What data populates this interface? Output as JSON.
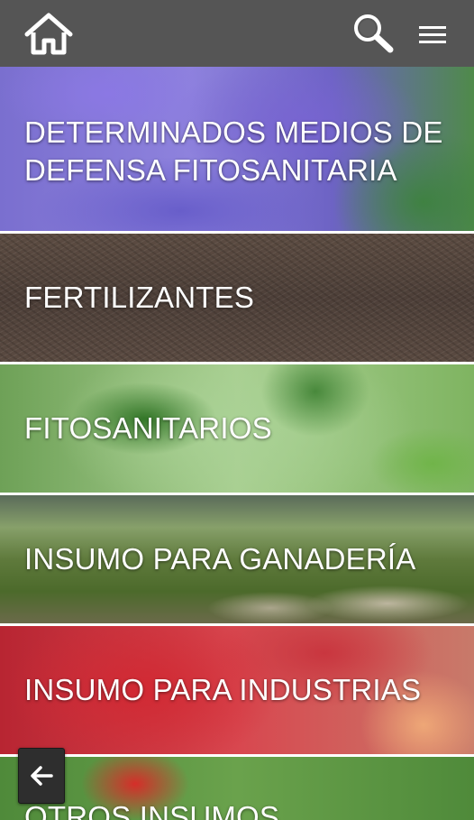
{
  "header": {
    "home_icon": "home-icon",
    "search_icon": "search-icon",
    "menu_icon": "hamburger-menu-icon",
    "bar_color": "#555555"
  },
  "categories": [
    {
      "label": "DETERMINADOS MEDIOS DE DEFENSA FITOSANITARIA",
      "image": "lavender-field"
    },
    {
      "label": "FERTILIZANTES",
      "image": "soil-mulch"
    },
    {
      "label": "FITOSANITARIOS",
      "image": "green-leaves"
    },
    {
      "label": "INSUMO PARA GANADERÍA",
      "image": "sheep-pasture"
    },
    {
      "label": "INSUMO PARA INDUSTRIAS",
      "image": "jam-jars"
    },
    {
      "label": "OTROS INSUMOS",
      "image": "red-poppy"
    }
  ],
  "back_button": {
    "icon": "arrow-left-icon"
  }
}
